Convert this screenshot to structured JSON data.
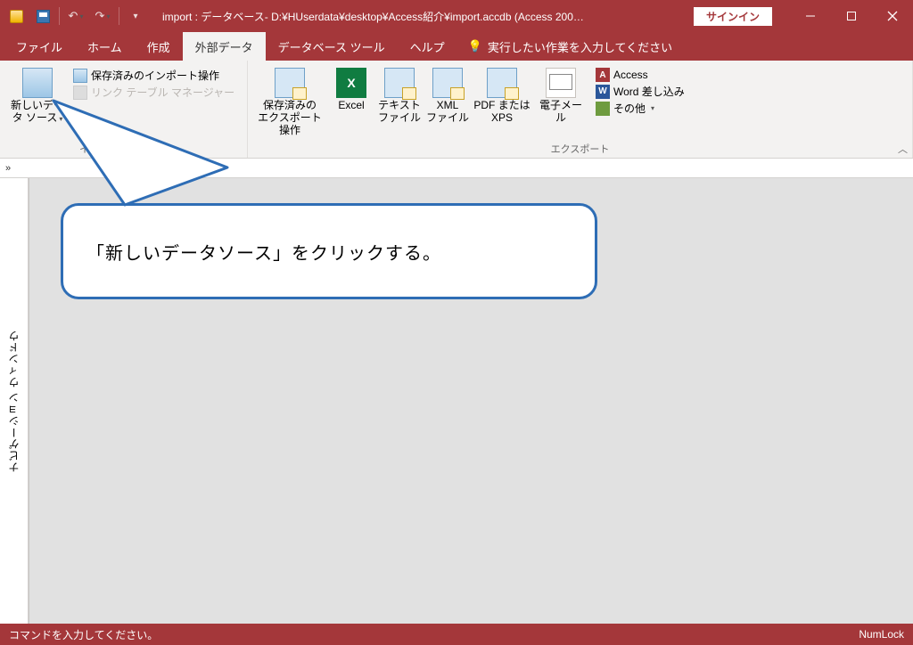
{
  "titlebar": {
    "title": "import : データベース- D:¥HUserdata¥desktop¥Access紹介¥import.accdb (Access 200…",
    "signin": "サインイン"
  },
  "tabs": {
    "file": "ファイル",
    "home": "ホーム",
    "create": "作成",
    "external": "外部データ",
    "dbtools": "データベース ツール",
    "help": "ヘルプ",
    "tellme": "実行したい作業を入力してください"
  },
  "ribbon": {
    "group_import": {
      "new_source": "新しいデー\nタ ソース",
      "saved_imports": "保存済みのインポート操作",
      "link_mgr": "リンク テーブル マネージャー",
      "label": "インポートとリンク"
    },
    "group_export": {
      "saved_exports": "保存済みの\nエクスポート操作",
      "excel": "Excel",
      "text": "テキスト\nファイル",
      "xml": "XML\nファイル",
      "pdf": "PDF または\nXPS",
      "mail": "電子メール",
      "access": "Access",
      "word": "Word 差し込み",
      "other": "その他",
      "label": "エクスポート"
    }
  },
  "navpane": {
    "label": "ナビゲーション ウィンドウ"
  },
  "callout": {
    "text": "「新しいデータソース」をクリックする。"
  },
  "statusbar": {
    "left": "コマンドを入力してください。",
    "right": "NumLock"
  }
}
